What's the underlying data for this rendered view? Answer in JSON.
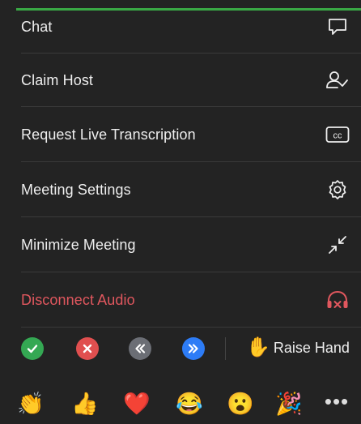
{
  "menu": {
    "items": [
      {
        "label": "Chat",
        "icon": "chat-bubble-icon"
      },
      {
        "label": "Claim Host",
        "icon": "claim-host-icon"
      },
      {
        "label": "Request Live Transcription",
        "icon": "closed-caption-icon"
      },
      {
        "label": "Meeting Settings",
        "icon": "gear-icon"
      },
      {
        "label": "Minimize Meeting",
        "icon": "minimize-arrows-icon"
      },
      {
        "label": "Disconnect Audio",
        "icon": "headphones-disconnect-icon"
      }
    ],
    "cc_text": "cc"
  },
  "reactions": {
    "raise_hand_label": "Raise Hand",
    "raise_hand_emoji": "✋",
    "buttons": [
      "yes-icon",
      "no-icon",
      "slower-icon",
      "faster-icon"
    ]
  },
  "emoji_bar": {
    "emojis": [
      "👏",
      "👍",
      "❤️",
      "😂",
      "😮",
      "🎉"
    ],
    "more_label": "•••"
  },
  "colors": {
    "panel_bg": "#232323",
    "text": "#eeeeee",
    "danger": "#e0575e",
    "accent_green": "#39a845",
    "yes_green": "#34a853",
    "no_red": "#e04f4f",
    "slower_gray": "#6b6e75",
    "faster_blue": "#2d7cf6"
  }
}
